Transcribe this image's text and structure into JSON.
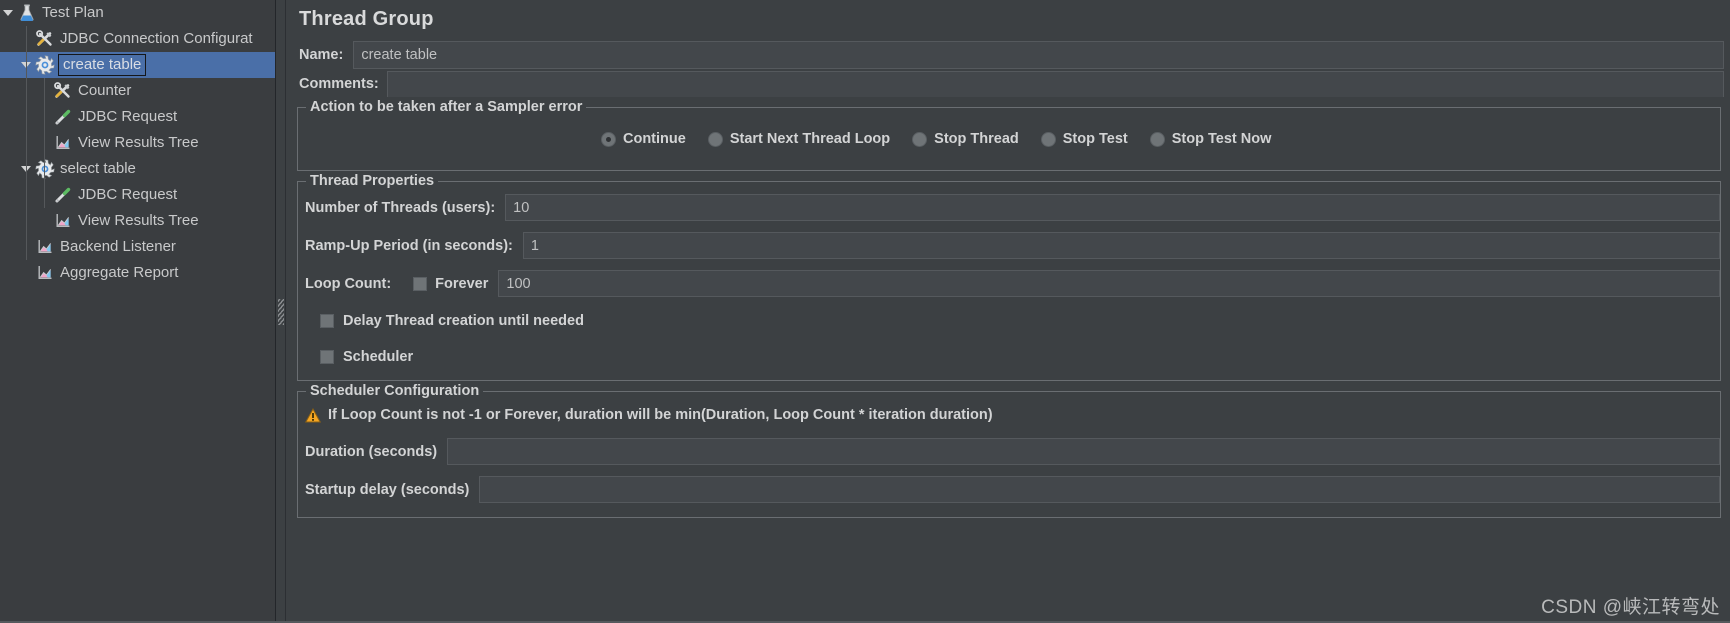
{
  "tree": {
    "items": [
      {
        "label": "Test Plan",
        "icon": "test-plan-icon",
        "depth": 0,
        "twisty": true,
        "selected": false
      },
      {
        "label": "JDBC Connection Configurat",
        "icon": "config-element-icon",
        "depth": 1,
        "twisty": false,
        "selected": false
      },
      {
        "label": "create table",
        "icon": "thread-group-icon",
        "depth": 1,
        "twisty": true,
        "selected": true
      },
      {
        "label": "Counter",
        "icon": "config-element-icon",
        "depth": 2,
        "twisty": false,
        "selected": false
      },
      {
        "label": "JDBC Request",
        "icon": "sampler-icon",
        "depth": 2,
        "twisty": false,
        "selected": false
      },
      {
        "label": "View Results Tree",
        "icon": "listener-icon",
        "depth": 2,
        "twisty": false,
        "selected": false
      },
      {
        "label": "select table",
        "icon": "thread-group-icon",
        "depth": 1,
        "twisty": true,
        "selected": false
      },
      {
        "label": "JDBC Request",
        "icon": "sampler-icon",
        "depth": 2,
        "twisty": false,
        "selected": false
      },
      {
        "label": "View Results Tree",
        "icon": "listener-icon",
        "depth": 2,
        "twisty": false,
        "selected": false
      },
      {
        "label": "Backend Listener",
        "icon": "listener-icon",
        "depth": 1,
        "twisty": false,
        "selected": false
      },
      {
        "label": "Aggregate Report",
        "icon": "listener-icon",
        "depth": 1,
        "twisty": false,
        "selected": false
      }
    ]
  },
  "panel": {
    "title": "Thread Group",
    "name_label": "Name:",
    "name_value": "create table",
    "comments_label": "Comments:",
    "comments_value": ""
  },
  "sampler_error": {
    "title": "Action to be taken after a Sampler error",
    "options": [
      {
        "label": "Continue",
        "selected": true
      },
      {
        "label": "Start Next Thread Loop",
        "selected": false
      },
      {
        "label": "Stop Thread",
        "selected": false
      },
      {
        "label": "Stop Test",
        "selected": false
      },
      {
        "label": "Stop Test Now",
        "selected": false
      }
    ]
  },
  "thread_properties": {
    "title": "Thread Properties",
    "num_threads_label": "Number of Threads (users):",
    "num_threads_value": "10",
    "ramp_up_label": "Ramp-Up Period (in seconds):",
    "ramp_up_value": "1",
    "loop_count_label": "Loop Count:",
    "forever_label": "Forever",
    "forever_checked": false,
    "loop_count_value": "100",
    "delay_thread_label": "Delay Thread creation until needed",
    "delay_thread_checked": false,
    "scheduler_label": "Scheduler",
    "scheduler_checked": false
  },
  "scheduler_config": {
    "title": "Scheduler Configuration",
    "warning_text": "If Loop Count is not -1 or Forever, duration will be min(Duration, Loop Count * iteration duration)",
    "duration_label": "Duration (seconds)",
    "duration_value": "",
    "startup_delay_label": "Startup delay (seconds)",
    "startup_delay_value": ""
  },
  "watermark": {
    "text": "CSDN @峡江转弯处"
  },
  "colors": {
    "selection": "#4a6fa8",
    "panel_bg": "#3c4043",
    "tree_bg": "#3a3d40",
    "field_bg": "#43474b",
    "border": "#6a6e72",
    "text": "#d3d4d5",
    "warning": "#f5a623"
  }
}
